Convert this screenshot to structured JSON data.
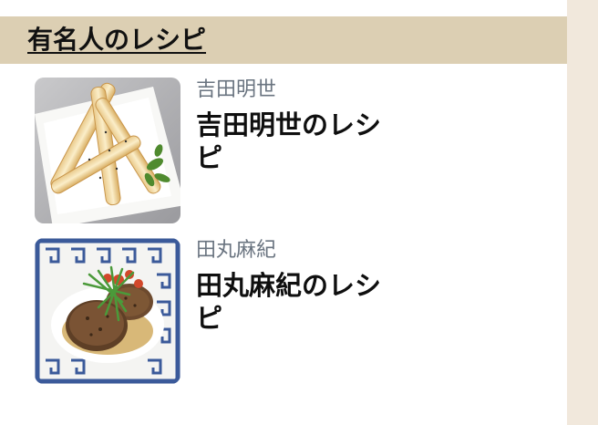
{
  "section": {
    "title": "有名人のレシピ"
  },
  "cards": [
    {
      "author": "吉田明世",
      "title": "吉田明世のレシピ",
      "image_icon": "spring-roll-sticks-photo"
    },
    {
      "author": "田丸麻紀",
      "title": "田丸麻紀のレシピ",
      "image_icon": "hamburg-steak-photo"
    }
  ],
  "colors": {
    "header_bg": "#dccfb3",
    "rail_bg": "#f1e8dc",
    "author_text": "#6a7480"
  }
}
